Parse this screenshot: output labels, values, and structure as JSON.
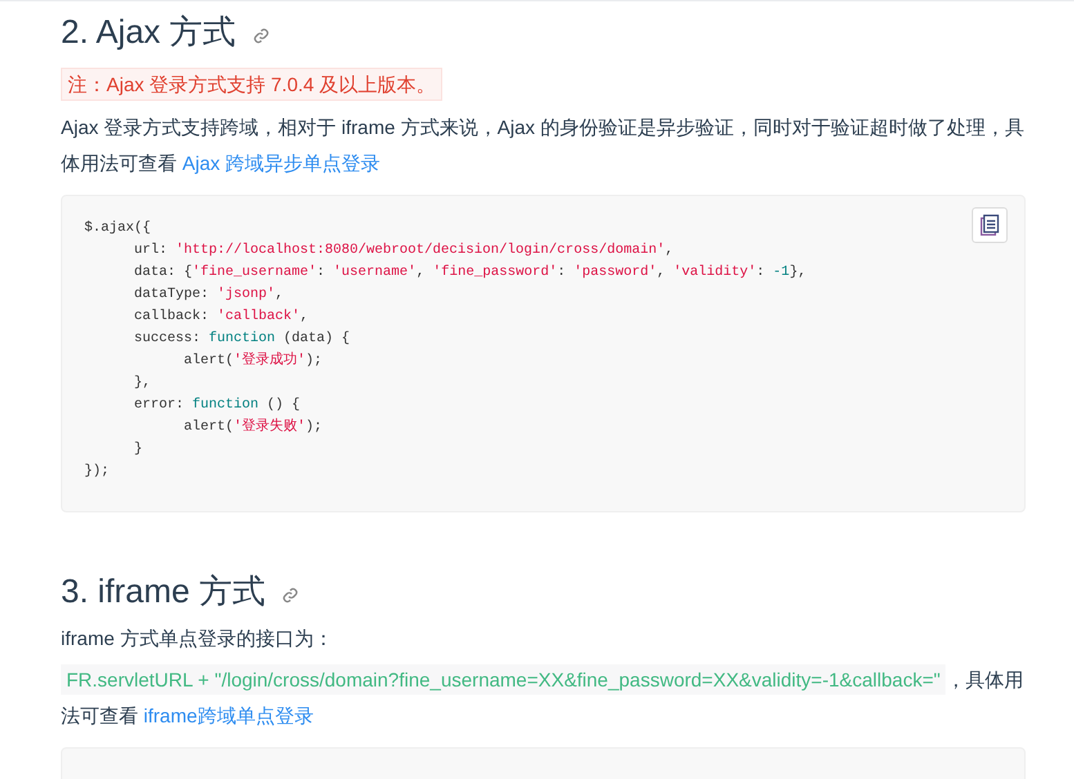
{
  "sections": [
    {
      "heading": "2. Ajax 方式",
      "note": "注：Ajax 登录方式支持 7.0.4 及以上版本。",
      "paragraph": [
        {
          "kind": "text",
          "text": "Ajax 登录方式支持跨域，相对于 iframe 方式来说，Ajax 的身份验证是异步验证，同时对于验证超时做了处理，具体用法可查看 "
        },
        {
          "kind": "link",
          "text": "Ajax 跨域异步单点登录"
        }
      ],
      "code": [
        [
          {
            "kind": "plain",
            "text": "$.ajax({"
          }
        ],
        [
          {
            "kind": "plain",
            "text": "      url: "
          },
          {
            "kind": "string",
            "text": "'http://localhost:8080/webroot/decision/login/cross/domain'"
          },
          {
            "kind": "plain",
            "text": ","
          }
        ],
        [
          {
            "kind": "plain",
            "text": "      data: {"
          },
          {
            "kind": "string",
            "text": "'fine_username'"
          },
          {
            "kind": "plain",
            "text": ": "
          },
          {
            "kind": "string",
            "text": "'username'"
          },
          {
            "kind": "plain",
            "text": ", "
          },
          {
            "kind": "string",
            "text": "'fine_password'"
          },
          {
            "kind": "plain",
            "text": ": "
          },
          {
            "kind": "string",
            "text": "'password'"
          },
          {
            "kind": "plain",
            "text": ", "
          },
          {
            "kind": "string",
            "text": "'validity'"
          },
          {
            "kind": "plain",
            "text": ": "
          },
          {
            "kind": "number",
            "text": "-1"
          },
          {
            "kind": "plain",
            "text": "},"
          }
        ],
        [
          {
            "kind": "plain",
            "text": "      dataType: "
          },
          {
            "kind": "string",
            "text": "'jsonp'"
          },
          {
            "kind": "plain",
            "text": ","
          }
        ],
        [
          {
            "kind": "plain",
            "text": "      callback: "
          },
          {
            "kind": "string",
            "text": "'callback'"
          },
          {
            "kind": "plain",
            "text": ","
          }
        ],
        [
          {
            "kind": "plain",
            "text": "      success: "
          },
          {
            "kind": "keyword",
            "text": "function"
          },
          {
            "kind": "plain",
            "text": " (data) {"
          }
        ],
        [
          {
            "kind": "plain",
            "text": "            alert("
          },
          {
            "kind": "string",
            "text": "'登录成功'"
          },
          {
            "kind": "plain",
            "text": ");"
          }
        ],
        [
          {
            "kind": "plain",
            "text": "      },"
          }
        ],
        [
          {
            "kind": "plain",
            "text": "      error: "
          },
          {
            "kind": "keyword",
            "text": "function"
          },
          {
            "kind": "plain",
            "text": " () {"
          }
        ],
        [
          {
            "kind": "plain",
            "text": "            alert("
          },
          {
            "kind": "string",
            "text": "'登录失败'"
          },
          {
            "kind": "plain",
            "text": ");"
          }
        ],
        [
          {
            "kind": "plain",
            "text": "      }"
          }
        ],
        [
          {
            "kind": "plain",
            "text": "});"
          }
        ]
      ]
    },
    {
      "heading": "3. iframe 方式",
      "paragraph": [
        {
          "kind": "text",
          "text": "iframe 方式单点登录的接口为："
        }
      ],
      "paragraph_2": [
        {
          "kind": "code",
          "text": "FR.servletURL + \"/login/cross/domain?fine_username=XX&fine_password=XX&validity=-1&callback=\""
        },
        {
          "kind": "text",
          "text": "，具体用法可查看 "
        },
        {
          "kind": "link",
          "text": "iframe跨域单点登录"
        }
      ]
    }
  ]
}
